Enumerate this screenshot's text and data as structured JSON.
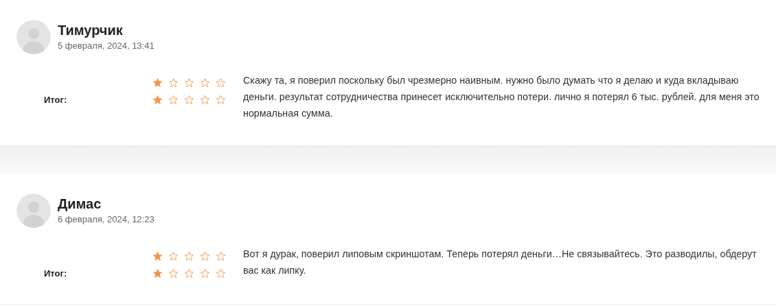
{
  "reviews": [
    {
      "name": "Тимурчик",
      "date": "5 февраля, 2024, 13:41",
      "ratings": [
        {
          "stars": 1
        },
        {
          "label": "Итог:",
          "stars": 1
        }
      ],
      "text": "Скажу та, я поверил поскольку был чрезмерно наивным. нужно было думать что я делаю и куда вкладываю деньги. результат сотрудничества принесет исключительно потери. лично я потерял 6 тыс. рублей. для меня это нормальная сумма."
    },
    {
      "name": "Димас",
      "date": "6 февраля, 2024, 12:23",
      "ratings": [
        {
          "stars": 1
        },
        {
          "label": "Итог:",
          "stars": 1
        }
      ],
      "text": "Вот я дурак, поверил липовым скриншотам. Теперь потерял деньги…Не связывайтесь. Это разводилы, обдерут вас как липку."
    }
  ]
}
